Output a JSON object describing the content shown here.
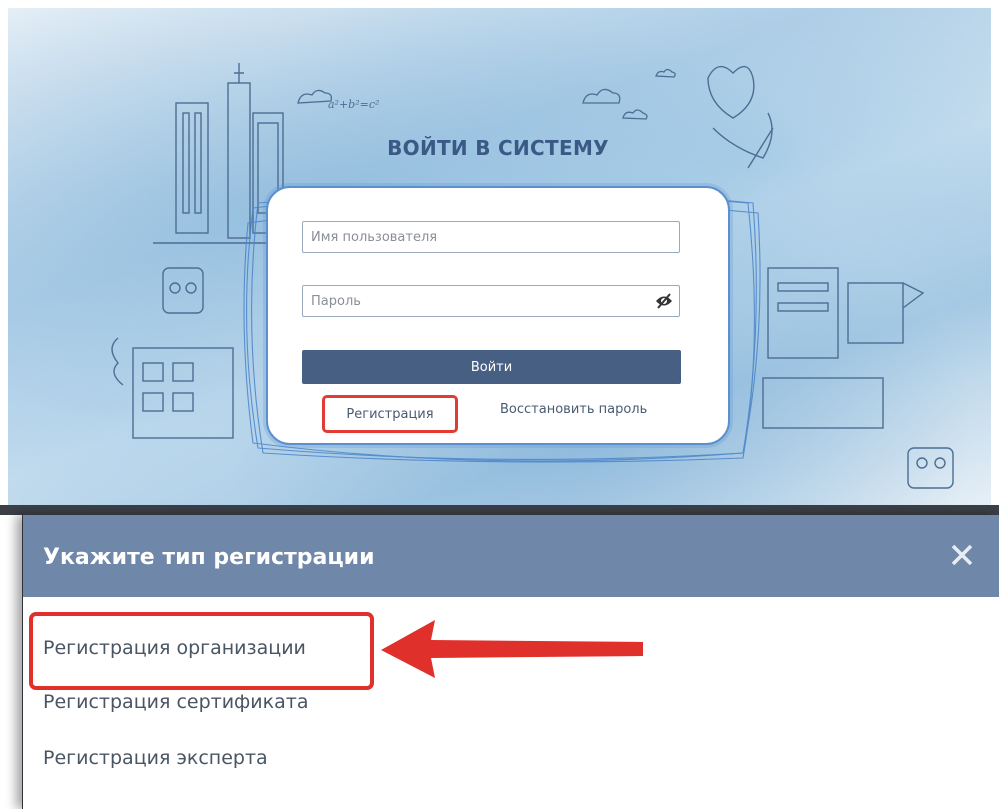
{
  "login": {
    "title": "ВОЙТИ В СИСТЕМУ",
    "username_placeholder": "Имя пользователя",
    "password_placeholder": "Пароль",
    "login_button": "Войти",
    "register_link": "Регистрация",
    "recover_link": "Восстановить пароль",
    "doodle_formula": "a²+b²=c²",
    "eye_icon": "eye-slash-icon"
  },
  "modal": {
    "title": "Укажите тип регистрации",
    "close_icon": "close-icon",
    "options": [
      "Регистрация организации",
      "Регистрация сертификата",
      "Регистрация эксперта"
    ]
  },
  "colors": {
    "accent_button": "#465f82",
    "modal_header": "#6f87a8",
    "highlight_red": "#e0302b",
    "title_blue": "#3a5a85"
  }
}
